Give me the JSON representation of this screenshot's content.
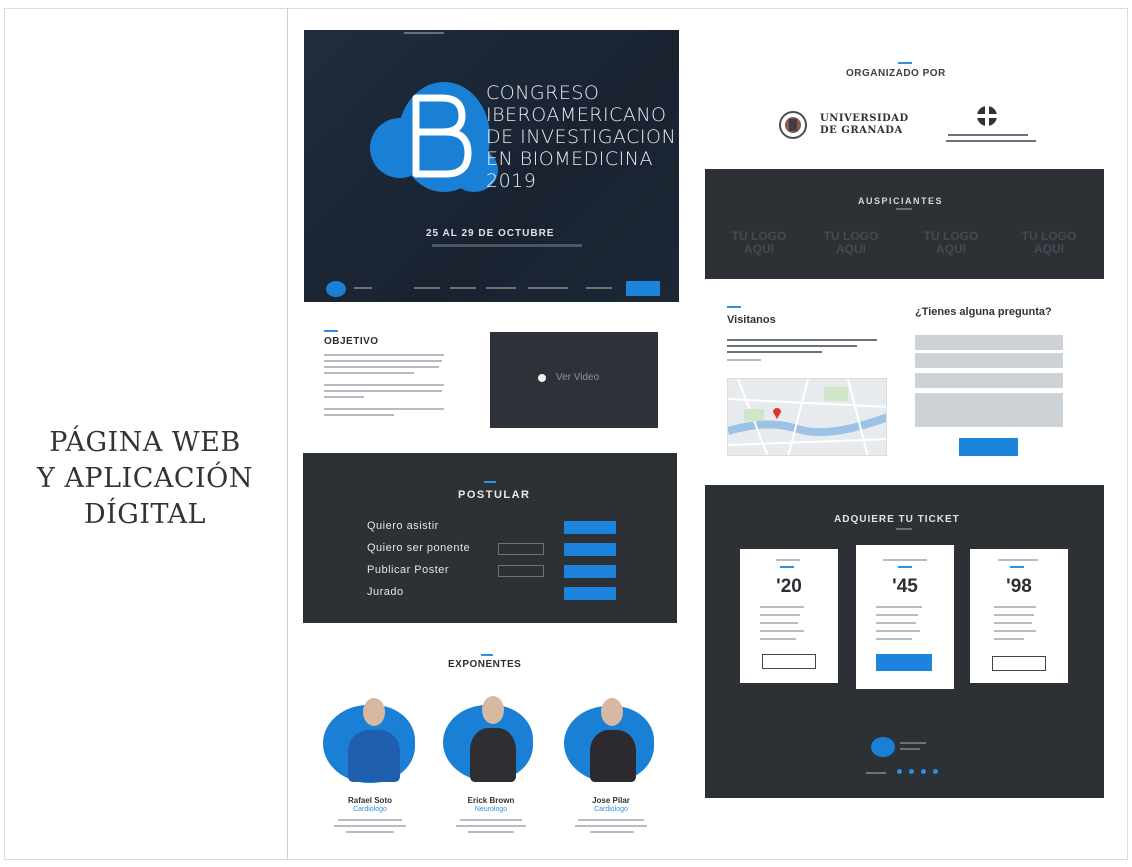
{
  "side_title": [
    "PÁGINA WEB",
    "Y APLICACIÓN",
    "DÍGITAL"
  ],
  "hero": {
    "title_lines": [
      "CONGRESO",
      "IBEROAMERICANO",
      "DE INVESTIGACION",
      "EN BIOMEDICINA",
      "2019"
    ],
    "date": "25 AL 29 DE OCTUBRE"
  },
  "objetivo": {
    "title": "OBJETIVO"
  },
  "video": {
    "label": "Ver Video"
  },
  "postular": {
    "title": "POSTULAR",
    "rows": [
      "Quiero asistir",
      "Quiero ser ponente",
      "Publicar Poster",
      "Jurado"
    ]
  },
  "exponentes": {
    "title": "EXPONENTES",
    "people": [
      {
        "name": "Rafael Soto",
        "role": "Cardiologo"
      },
      {
        "name": "Erick Brown",
        "role": "Neurologo"
      },
      {
        "name": "Jose Pilar",
        "role": "Cardiologo"
      }
    ]
  },
  "organizado": {
    "title": "ORGANIZADO POR",
    "ugr_line1": "UNIVERSIDAD",
    "ugr_line2": "DE GRANADA"
  },
  "auspiciantes": {
    "title": "AUSPICIANTES",
    "slots": [
      {
        "line1": "TU LOGO",
        "line2": "AQUI"
      },
      {
        "line1": "TU LOGO",
        "line2": "AQUI"
      },
      {
        "line1": "TU LOGO",
        "line2": "AQUI"
      },
      {
        "line1": "TU LOGO",
        "line2": "AQUI"
      }
    ]
  },
  "visitanos": {
    "title": "Visitanos"
  },
  "faq": {
    "title": "¿Tienes alguna pregunta?"
  },
  "ticket": {
    "title": "ADQUIERE TU TICKET",
    "plans": [
      {
        "price": "'20"
      },
      {
        "price": "'45"
      },
      {
        "price": "'98"
      }
    ]
  },
  "colors": {
    "accent": "#1c84dd",
    "dark_panel": "#2d3136"
  }
}
